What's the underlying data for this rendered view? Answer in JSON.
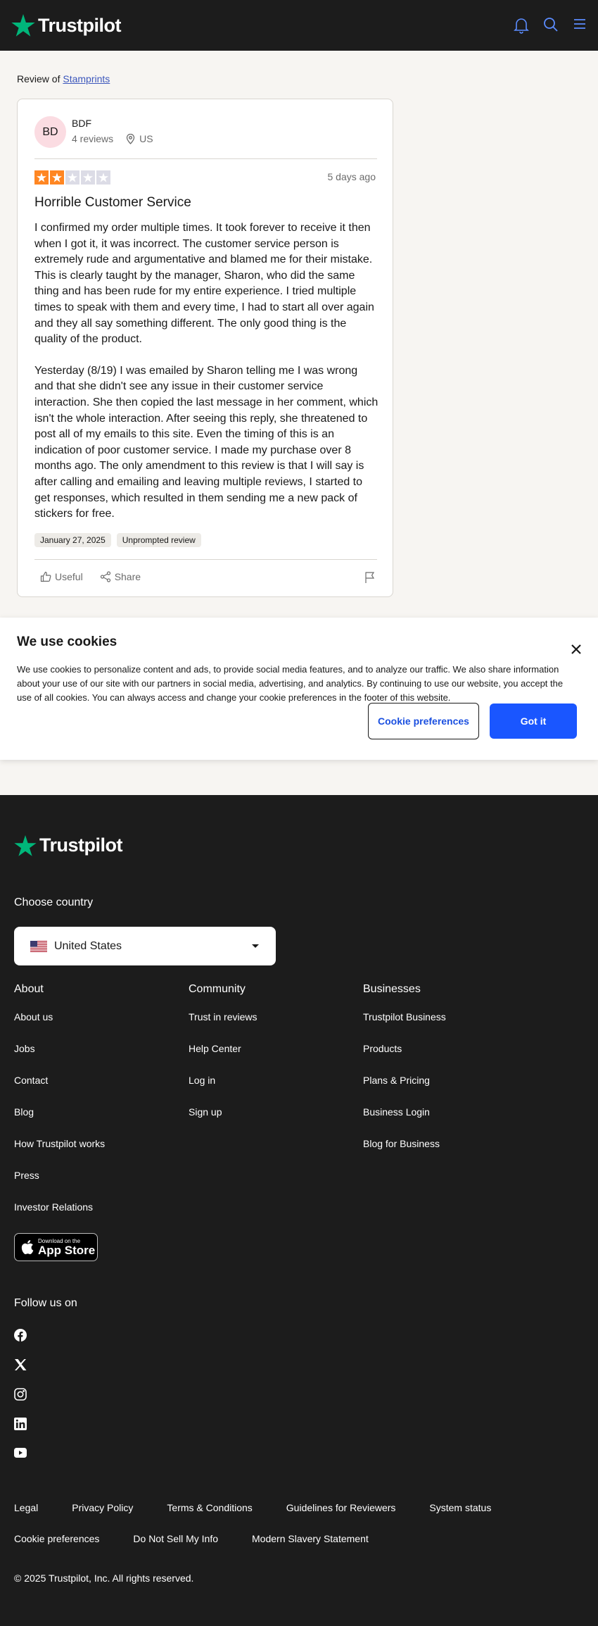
{
  "header": {
    "brand": "Trustpilot"
  },
  "main": {
    "review_of_prefix": "Review of",
    "company": "Stamprints"
  },
  "review": {
    "avatar_initials": "BD",
    "user_name": "BDF",
    "review_count": "4 reviews",
    "country": "US",
    "rating": 2,
    "rating_max": 5,
    "rating_color": "#ff8622",
    "time_ago": "5 days ago",
    "title": "Horrible Customer Service",
    "paragraphs": [
      "I confirmed my order multiple times. It took forever to receive it then when I got it, it was incorrect. The customer service person is extremely rude and argumentative and blamed me for their mistake. This is clearly taught by the manager, Sharon, who did the same thing and has been rude for my entire experience. I tried multiple times to speak with them and every time, I had to start all over again and they all say something different. The only good thing is the quality of the product.",
      "Yesterday (8/19) I was emailed by Sharon telling me I was wrong and that she didn't see any issue in their customer service interaction. She then copied the last message in her comment, which isn't the whole interaction. After seeing this reply, she threatened to post all of my emails to this site. Even the timing of this is an indication of poor customer service. I made my purchase over 8 months ago. The only amendment to this review is that I will say is after calling and emailing and leaving multiple reviews, I started to get responses, which resulted in them sending me a new pack of stickers for free."
    ],
    "date_chip": "January 27, 2025",
    "type_chip": "Unprompted review",
    "useful_label": "Useful",
    "share_label": "Share"
  },
  "cookie": {
    "title": "We use cookies",
    "text": "We use cookies to personalize content and ads, to provide social media features, and to analyze our traffic. We also share information about your use of our site with our partners in social media, advertising, and analytics. By continuing to use our website, you accept the use of all cookies. You can always access and change your cookie preferences in the footer of this website.",
    "preferences_label": "Cookie preferences",
    "accept_label": "Got it"
  },
  "footer": {
    "brand": "Trustpilot",
    "choose_country": "Choose country",
    "country_selected": "United States",
    "columns": [
      {
        "title": "About",
        "links": [
          "About us",
          "Jobs",
          "Contact",
          "Blog",
          "How Trustpilot works",
          "Press",
          "Investor Relations"
        ]
      },
      {
        "title": "Community",
        "links": [
          "Trust in reviews",
          "Help Center",
          "Log in",
          "Sign up"
        ]
      },
      {
        "title": "Businesses",
        "links": [
          "Trustpilot Business",
          "Products",
          "Plans & Pricing",
          "Business Login",
          "Blog for Business"
        ]
      }
    ],
    "appstore_small": "Download on the",
    "appstore_big": "App Store",
    "follow_us": "Follow us on",
    "social_icons": [
      "facebook-icon",
      "x-icon",
      "instagram-icon",
      "linkedin-icon",
      "youtube-icon"
    ],
    "legal_row1": [
      "Legal",
      "Privacy Policy",
      "Terms & Conditions",
      "Guidelines for Reviewers",
      "System status"
    ],
    "legal_row2": [
      "Cookie preferences",
      "Do Not Sell My Info",
      "Modern Slavery Statement"
    ],
    "copyright": "© 2025 Trustpilot, Inc. All rights reserved."
  },
  "colors": {
    "brand_green": "#00b67a",
    "primary_blue": "#1a56ff",
    "footer_bg": "#1c1c1c"
  }
}
